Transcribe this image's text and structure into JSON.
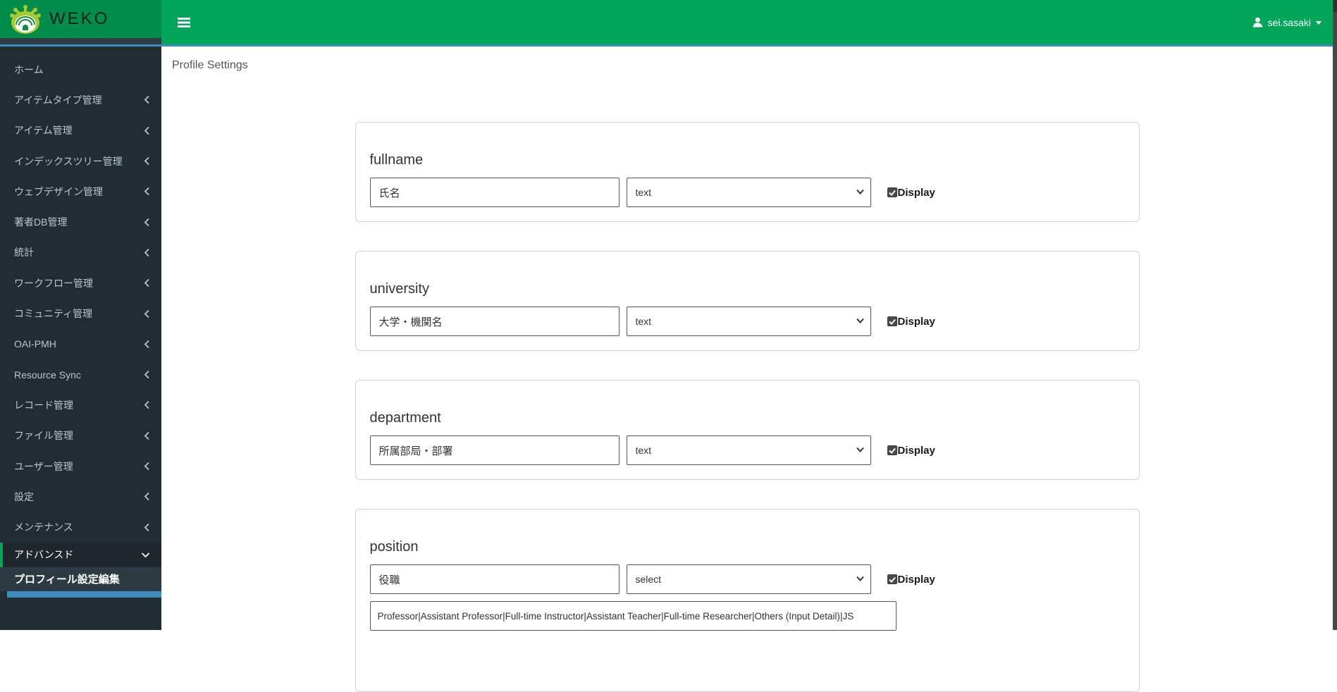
{
  "header": {
    "brand": "WEKO",
    "user_name": "sei.sasaki"
  },
  "page": {
    "title": "Profile Settings"
  },
  "sidebar": {
    "items": [
      {
        "label": "ホーム",
        "chevron": false
      },
      {
        "label": "アイテムタイプ管理",
        "chevron": true
      },
      {
        "label": "アイテム管理",
        "chevron": true
      },
      {
        "label": "インデックスツリー管理",
        "chevron": true
      },
      {
        "label": "ウェブデザイン管理",
        "chevron": true
      },
      {
        "label": "著者DB管理",
        "chevron": true
      },
      {
        "label": "統計",
        "chevron": true
      },
      {
        "label": "ワークフロー管理",
        "chevron": true
      },
      {
        "label": "コミュニティ管理",
        "chevron": true
      },
      {
        "label": "OAI-PMH",
        "chevron": true
      },
      {
        "label": "Resource Sync",
        "chevron": true
      },
      {
        "label": "レコード管理",
        "chevron": true
      },
      {
        "label": "ファイル管理",
        "chevron": true
      },
      {
        "label": "ユーザー管理",
        "chevron": true
      },
      {
        "label": "設定",
        "chevron": true
      },
      {
        "label": "メンテナンス",
        "chevron": true
      },
      {
        "label": "アドバンスド",
        "chevron": "down",
        "active": true
      }
    ],
    "submenu_item": "プロフィール設定編集"
  },
  "form": {
    "display_label": "Display",
    "cards": [
      {
        "title": "fullname",
        "value": "氏名",
        "type": "text",
        "display_checked": true
      },
      {
        "title": "university",
        "value": "大学・機関名",
        "type": "text",
        "display_checked": true
      },
      {
        "title": "department",
        "value": "所属部局・部署",
        "type": "text",
        "display_checked": true
      },
      {
        "title": "position",
        "value": "役職",
        "type": "select",
        "display_checked": true,
        "options_value": "Professor|Assistant Professor|Full-time Instructor|Assistant Teacher|Full-time Researcher|Others (Input Detail)|JS"
      }
    ]
  },
  "icons": {
    "logo": "weko-logo",
    "hamburger": "bars-icon",
    "user": "user-icon",
    "user_caret": "caret-down-icon",
    "collapsed": "angle-left-icon",
    "expanded": "angle-down-icon",
    "select_arrow": "chevron-down-icon",
    "display_check": "checkbox-checked-icon"
  },
  "colors": {
    "navbar_green": "#00a65a",
    "logo_green": "#008d4c",
    "accent_blue": "#3d8dbc",
    "sidebar_bg": "#222d32",
    "sidebar_text": "#b8c7ce",
    "submenu_bg": "#2c3b41",
    "active_border": "#00a65a"
  }
}
